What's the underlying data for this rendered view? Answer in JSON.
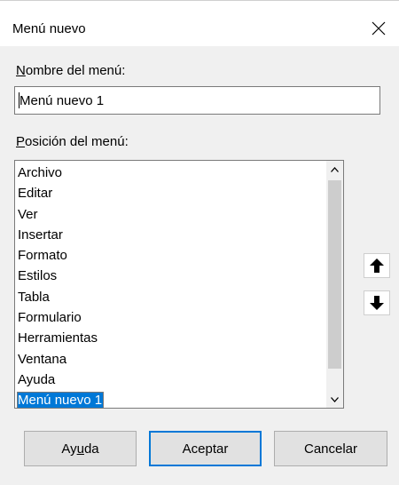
{
  "window": {
    "title": "Menú nuevo",
    "close_icon": "close-icon"
  },
  "name_field": {
    "label_accel": "N",
    "label_rest": "ombre del menú:",
    "value": "Menú nuevo 1"
  },
  "position": {
    "label_accel": "P",
    "label_rest": "osición del menú:",
    "items": [
      "Archivo",
      "Editar",
      "Ver",
      "Insertar",
      "Formato",
      "Estilos",
      "Tabla",
      "Formulario",
      "Herramientas",
      "Ventana",
      "Ayuda",
      "Menú nuevo 1"
    ],
    "selected_index": 11,
    "scroll_up_icon": "chevron-up-icon",
    "scroll_down_icon": "chevron-down-icon"
  },
  "move_buttons": {
    "up_icon": "arrow-up-icon",
    "down_icon": "arrow-down-icon"
  },
  "buttons": {
    "help_pre": "Ay",
    "help_accel": "u",
    "help_post": "da",
    "ok": "Aceptar",
    "cancel": "Cancelar"
  },
  "colors": {
    "selection": "#0078d7",
    "dialog_bg": "#f0f0f0",
    "default_button_border": "#0078d7"
  }
}
